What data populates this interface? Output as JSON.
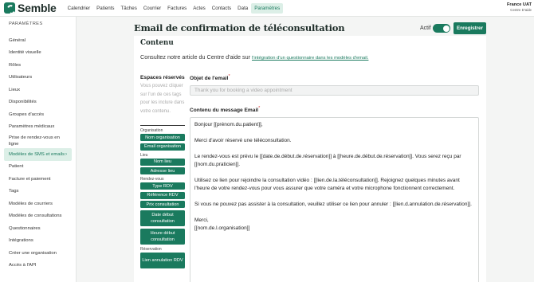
{
  "app": {
    "logo_text": "Semble"
  },
  "nav": [
    "Calendrier",
    "Patients",
    "Tâches",
    "Courrier",
    "Factures",
    "Actes",
    "Contacts",
    "Data",
    "Paramètres"
  ],
  "user": {
    "name": "France UAT",
    "sub": "Centre D'aide"
  },
  "sidebar": {
    "title": "PARAMÈTRES",
    "items": [
      "Général",
      "Identité visuelle",
      "Rôles",
      "Utilisateurs",
      "Lieux",
      "Disponibilités",
      "Groupes d'accès",
      "Paramètres médicaux",
      "Prise de rendez-vous en ligne",
      "Modèles de SMS et emails",
      "Patient",
      "Facture et paiement",
      "Tags",
      "Modèles de courriers",
      "Modèles de consultations",
      "Questionnaires",
      "Intégrations",
      "Créer une organisation",
      "Accès à l'API"
    ],
    "active_chevron": "›"
  },
  "header": {
    "title": "Email de confirmation de téléconsultation",
    "actif_label": "Actif",
    "save_label": "Enregistrer"
  },
  "card": {
    "heading": "Contenu",
    "help_text": "Consultez notre article du Centre d'aide sur ",
    "help_link": "l'intégration d'un questionnaire dans les modèles d'email."
  },
  "variables": {
    "title": "Espaces réservés",
    "hint": "Vous pouvez cliquer sur l'un de ces tags pour les inclure dans votre contenu.",
    "groups": [
      {
        "label": "Organisation",
        "tags": [
          "Nom organisation",
          "Email organisation"
        ]
      },
      {
        "label": "Lieu",
        "tags": [
          "Nom lieu",
          "Adresse lieu"
        ]
      },
      {
        "label": "Rendez-vous",
        "tags": [
          "Type RDV",
          "Référence RDV",
          "Prix consultation",
          "Date début consultation",
          "Heure début consultation"
        ]
      },
      {
        "label": "Réservation",
        "tags": [
          "Lien annulation RDV"
        ]
      }
    ]
  },
  "subject": {
    "label": "Objet de l'email",
    "required_mark": "*",
    "placeholder": "Thank you for booking a video appointment"
  },
  "message": {
    "label": "Contenu du message Email",
    "required_mark": "*",
    "lines": [
      "Bonjour [[prénom.du.patient]],",
      "",
      "Merci d'avoir réservé une téléconsultation.",
      "",
      "Le rendez-vous est prévu le [[date.de.début.de.réservation]] à [[heure.de.début.de.réservation]]. Vous serez reçu par [[nom.du.praticien]].",
      "",
      "Utilisez ce lien pour rejoindre la consultation vidéo : [[lien.de.la.téléconsultation]]. Rejoignez quelques minutes avant l'heure de votre rendez-vous pour vous assurer que votre caméra et votre microphone fonctionnent correctement.",
      "",
      "Si vous ne pouvez pas assister à la consultation, veuillez utiliser ce lien pour annuler : [[lien.d.annulation.de.réservation]].",
      "",
      "Merci,",
      "[[nom.de.l.organisation]]"
    ]
  },
  "colors": {
    "brand": "#1a7a5e",
    "active_bg": "#dcefe7",
    "required": "#dd3333"
  }
}
